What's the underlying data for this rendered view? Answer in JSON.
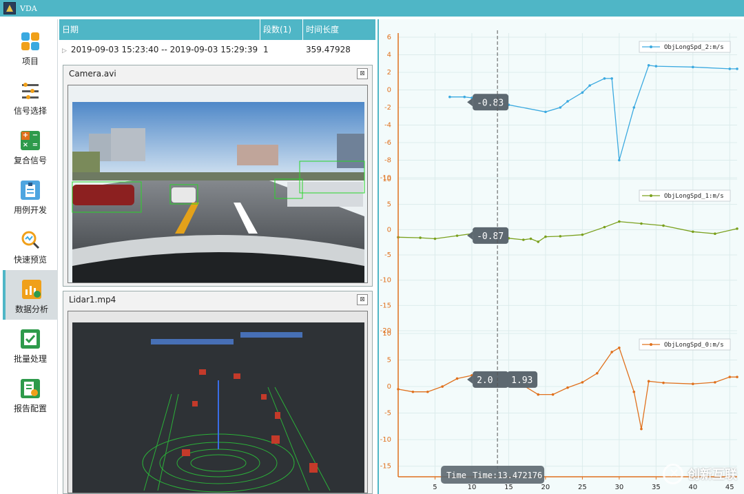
{
  "app": {
    "title": "VDA"
  },
  "nav": {
    "items": [
      {
        "label": "项目",
        "icon": "project-grid-icon"
      },
      {
        "label": "信号选择",
        "icon": "signal-select-icon"
      },
      {
        "label": "复合信号",
        "icon": "calculator-icon"
      },
      {
        "label": "用例开发",
        "icon": "clipboard-icon"
      },
      {
        "label": "快速预览",
        "icon": "magnifier-icon"
      },
      {
        "label": "数据分析",
        "icon": "analysis-chart-icon",
        "active": true
      },
      {
        "label": "批量处理",
        "icon": "batch-check-icon"
      },
      {
        "label": "报告配置",
        "icon": "report-icon"
      }
    ]
  },
  "table": {
    "headers": [
      "日期",
      "段数(1)",
      "时间长度"
    ],
    "rows": [
      {
        "date": "2019-09-03 15:23:40 -- 2019-09-03 15:29:39",
        "segments": "1",
        "length": "359.47928"
      }
    ]
  },
  "panels": {
    "camera": {
      "title": "Camera.avi",
      "close": "⊠"
    },
    "lidar": {
      "title": "Lidar1.mp4",
      "close": "⊠"
    }
  },
  "colors": {
    "accent": "#4fb6c6",
    "series2": "#3aa9e0",
    "series1": "#7aa01c",
    "series0": "#e0701c"
  },
  "chart_data": [
    {
      "type": "line",
      "series": [
        {
          "name": "ObjLongSpd_2:m/s",
          "x": [
            7,
            9,
            10,
            13,
            15,
            20,
            22,
            23,
            25,
            26,
            28,
            29,
            30,
            32,
            34,
            35,
            40,
            45,
            46
          ],
          "y": [
            -0.8,
            -0.8,
            -0.9,
            -1.3,
            -1.7,
            -2.5,
            -2.0,
            -1.3,
            -0.3,
            0.5,
            1.3,
            1.3,
            -8.0,
            -2.0,
            2.8,
            2.7,
            2.6,
            2.4,
            2.4
          ]
        }
      ],
      "yticks": [
        "6",
        "4",
        "2",
        "0",
        "-2",
        "-4",
        "-6",
        "-8",
        "-10"
      ],
      "ylim": [
        -10,
        6
      ],
      "tooltip": "-0.83"
    },
    {
      "type": "line",
      "series": [
        {
          "name": "ObjLongSpd_1:m/s",
          "x": [
            0,
            3,
            5,
            8,
            10,
            13,
            15,
            17,
            18,
            19,
            20,
            22,
            25,
            28,
            30,
            33,
            36,
            40,
            43,
            46
          ],
          "y": [
            -1.5,
            -1.6,
            -1.8,
            -1.2,
            -0.8,
            -1.0,
            -1.7,
            -2.0,
            -1.8,
            -2.4,
            -1.4,
            -1.3,
            -1.0,
            0.5,
            1.6,
            1.2,
            0.8,
            -0.4,
            -0.8,
            0.2
          ]
        }
      ],
      "yticks": [
        "10",
        "5",
        "0",
        "-5",
        "-10",
        "-15",
        "-20"
      ],
      "ylim": [
        -20,
        10
      ],
      "tooltip": "-0.87"
    },
    {
      "type": "line",
      "series": [
        {
          "name": "ObjLongSpd_0:m/s",
          "x": [
            0,
            2,
            4,
            6,
            8,
            10,
            12,
            14,
            17,
            19,
            21,
            23,
            25,
            27,
            29,
            30,
            32,
            33,
            34,
            36,
            40,
            43,
            45,
            46
          ],
          "y": [
            -0.5,
            -1.0,
            -1.0,
            0.0,
            1.5,
            2.1,
            1.9,
            1.1,
            0.2,
            -1.5,
            -1.5,
            -0.2,
            0.8,
            2.5,
            6.5,
            7.3,
            -1.0,
            -8.0,
            1.0,
            0.7,
            0.5,
            0.8,
            1.8,
            1.8
          ]
        }
      ],
      "yticks": [
        "10",
        "5",
        "0",
        "-5",
        "-10",
        "-15"
      ],
      "ylim": [
        -17,
        10
      ],
      "tooltips": [
        "2.0",
        "1.93"
      ]
    }
  ],
  "xaxis": {
    "ticks": [
      "5",
      "10",
      "15",
      "20",
      "25",
      "30",
      "35",
      "40",
      "45"
    ],
    "min": 0,
    "max": 46,
    "cursor": 13.472176
  },
  "time_label": {
    "left": "Time",
    "right": "Time:13.472176"
  },
  "watermark": {
    "text": "创新互联"
  }
}
